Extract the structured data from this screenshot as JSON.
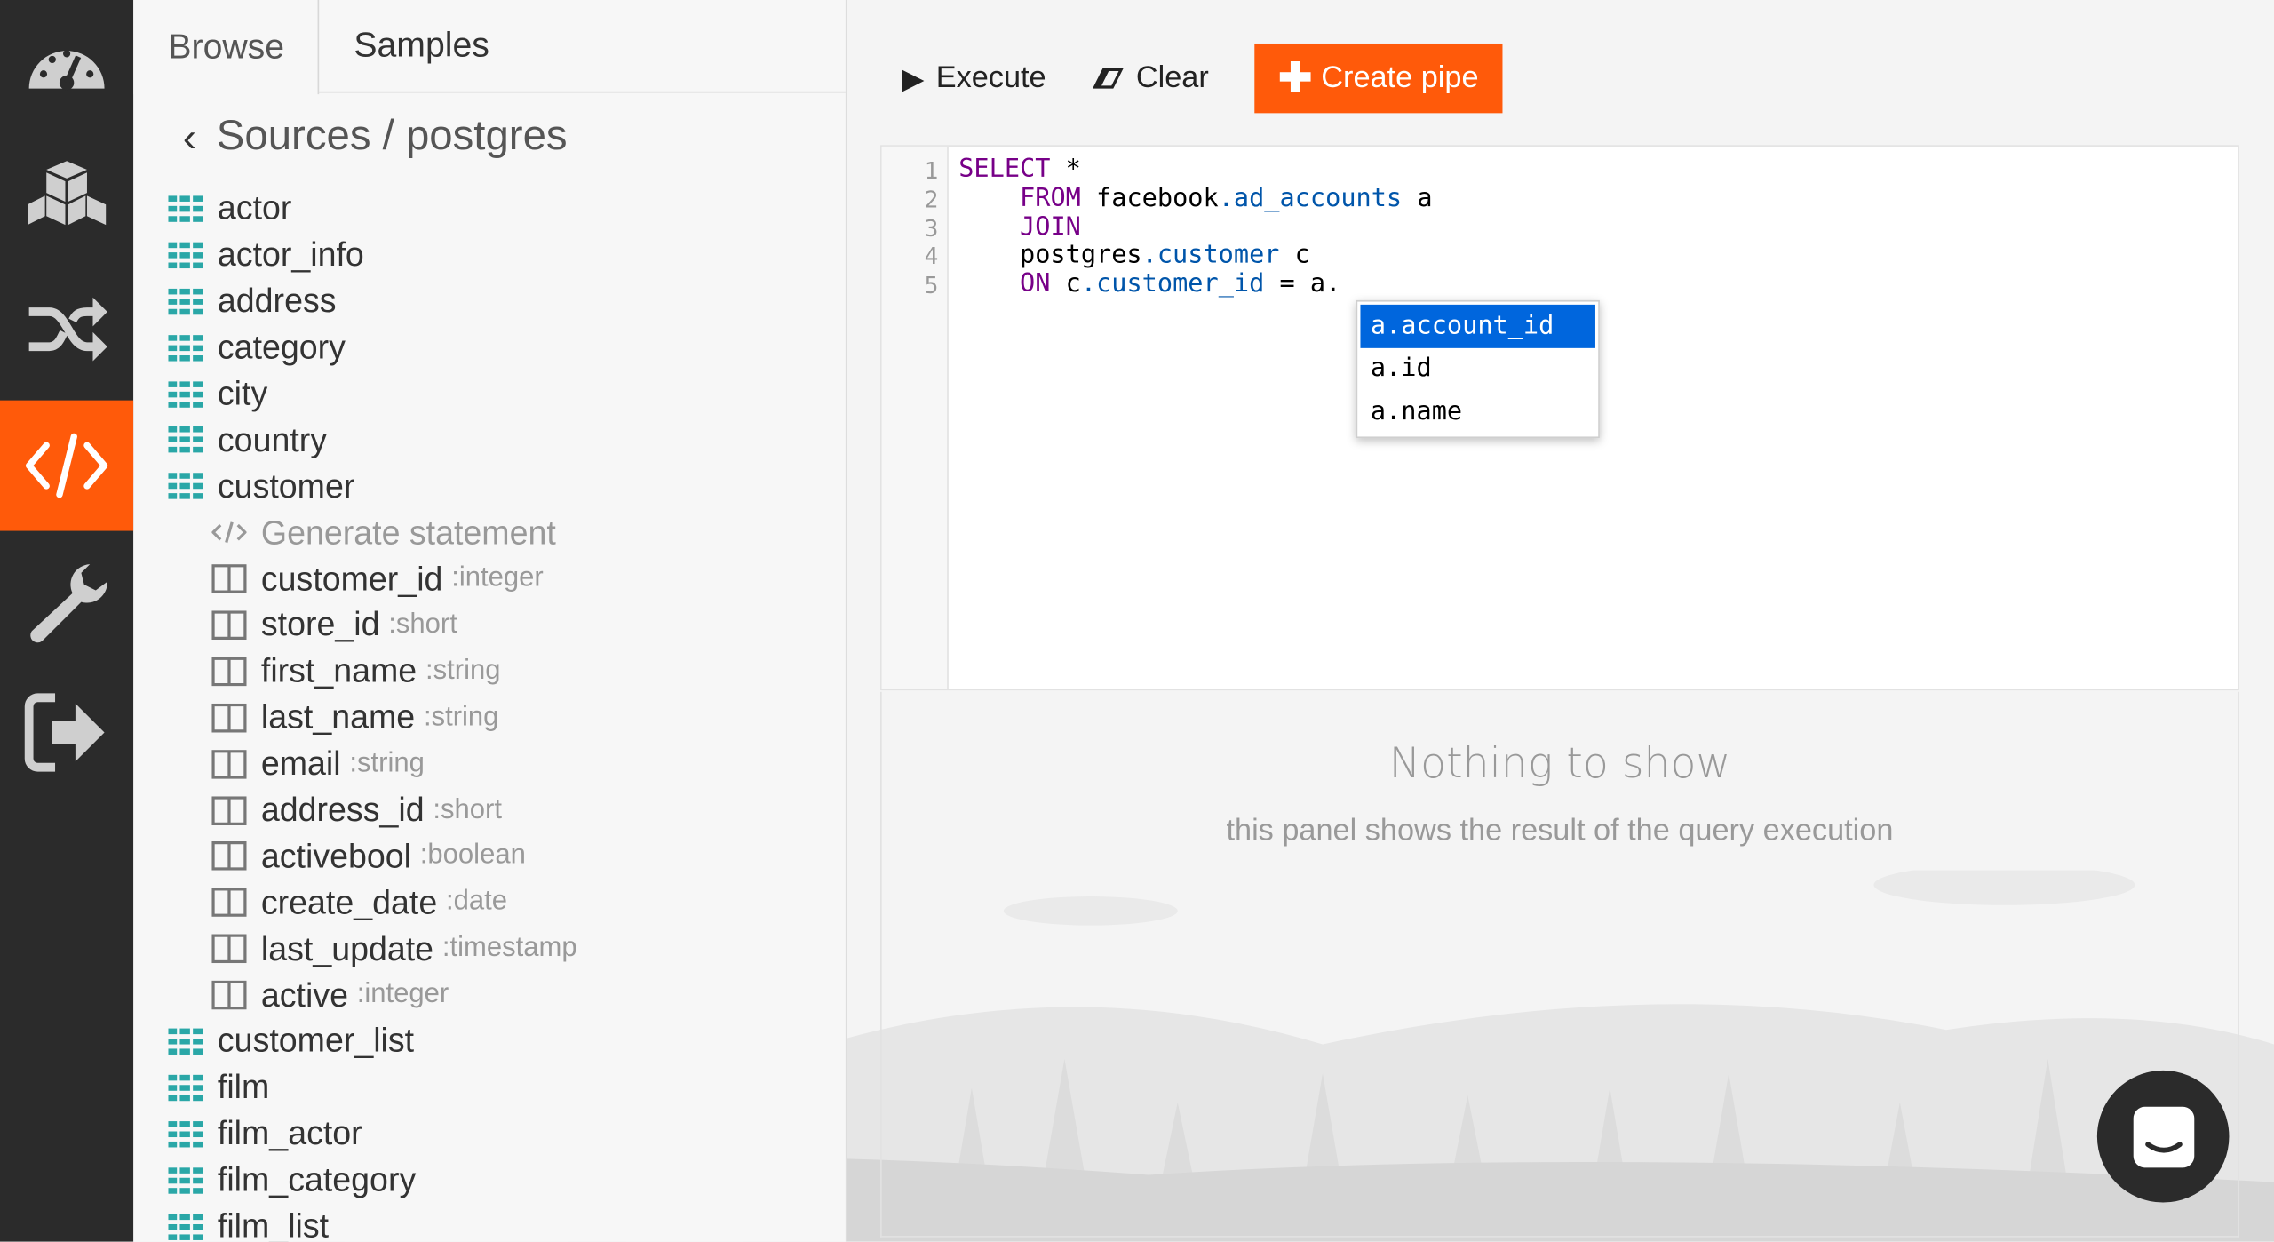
{
  "rail": {
    "items": [
      {
        "name": "dashboard",
        "icon": "speedometer-icon"
      },
      {
        "name": "sources",
        "icon": "cubes-icon"
      },
      {
        "name": "pipes",
        "icon": "shuffle-icon"
      },
      {
        "name": "query",
        "icon": "code-icon",
        "active": true
      },
      {
        "name": "settings",
        "icon": "wrench-icon"
      },
      {
        "name": "logout",
        "icon": "sign-out-icon"
      }
    ],
    "accent": "#ff5a0a"
  },
  "browser": {
    "tabs": [
      "Browse",
      "Samples"
    ],
    "breadcrumb": "Sources / postgres",
    "tables_before": [
      "actor",
      "actor_info",
      "address",
      "category",
      "city",
      "country",
      "customer"
    ],
    "generate_statement": "Generate statement",
    "columns": [
      {
        "name": "customer_id",
        "type": ":integer"
      },
      {
        "name": "store_id",
        "type": ":short"
      },
      {
        "name": "first_name",
        "type": ":string"
      },
      {
        "name": "last_name",
        "type": ":string"
      },
      {
        "name": "email",
        "type": ":string"
      },
      {
        "name": "address_id",
        "type": ":short"
      },
      {
        "name": "activebool",
        "type": ":boolean"
      },
      {
        "name": "create_date",
        "type": ":date"
      },
      {
        "name": "last_update",
        "type": ":timestamp"
      },
      {
        "name": "active",
        "type": ":integer"
      }
    ],
    "tables_after": [
      "customer_list",
      "film",
      "film_actor",
      "film_category",
      "film_list"
    ]
  },
  "toolbar": {
    "execute_label": "Execute",
    "clear_label": "Clear",
    "create_label": "Create pipe"
  },
  "editor": {
    "line_numbers": [
      "1",
      "2",
      "3",
      "4",
      "5"
    ],
    "autocomplete": [
      "a.account_id",
      "a.id",
      "a.name"
    ]
  },
  "results": {
    "title": "Nothing to show",
    "subtitle": "this panel shows the result of the query execution"
  }
}
